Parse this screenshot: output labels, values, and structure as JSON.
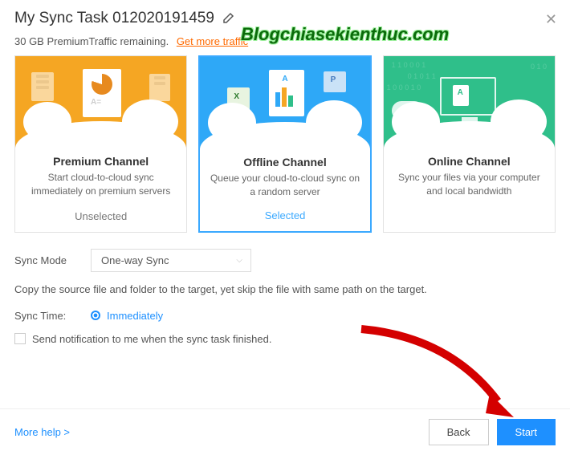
{
  "header": {
    "title": "My Sync Task 012020191459"
  },
  "watermark": "Blogchiasekienthuc.com",
  "traffic": {
    "remaining": "30 GB PremiumTraffic remaining.",
    "link": "Get more traffic"
  },
  "cards": [
    {
      "title": "Premium Channel",
      "desc": "Start cloud-to-cloud sync immediately on premium servers",
      "state": "Unselected",
      "selected": false
    },
    {
      "title": "Offline Channel",
      "desc": "Queue your cloud-to-cloud sync on a random server",
      "state": "Selected",
      "selected": true
    },
    {
      "title": "Online Channel",
      "desc": "Sync your files via your computer and local bandwidth",
      "state": "",
      "selected": false
    }
  ],
  "syncMode": {
    "label": "Sync Mode",
    "value": "One-way Sync",
    "description": "Copy the source file and folder to the target, yet skip the file with same path on the target."
  },
  "syncTime": {
    "label": "Sync Time:",
    "value": "Immediately"
  },
  "notify": {
    "label": "Send notification to me when the sync task finished."
  },
  "footer": {
    "moreHelp": "More help >",
    "back": "Back",
    "start": "Start"
  }
}
